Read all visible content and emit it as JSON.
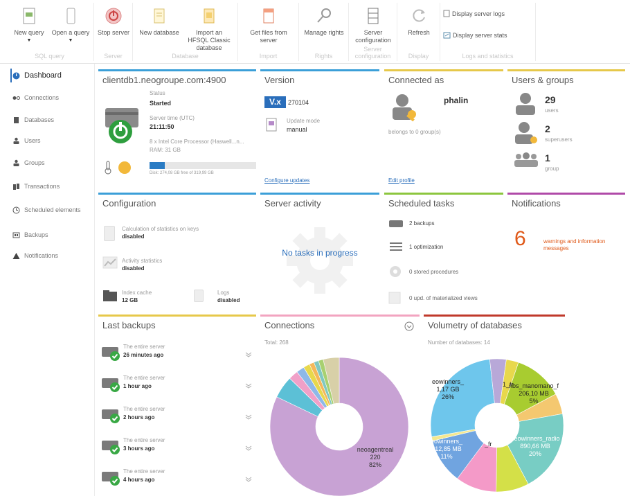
{
  "ribbon": {
    "groups": [
      {
        "title": "SQL query"
      },
      {
        "title": "Server"
      },
      {
        "title": "Database"
      },
      {
        "title": "Import"
      },
      {
        "title": "Rights"
      },
      {
        "title": "Server configuration"
      },
      {
        "title": "Display"
      },
      {
        "title": "Logs and statistics"
      }
    ],
    "buttons": {
      "new_query": "New query",
      "open_query": "Open a query",
      "stop_server": "Stop server",
      "new_database": "New database",
      "import_hfsql": "Import an HFSQL Classic database",
      "get_files": "Get files from server",
      "manage_rights": "Manage rights",
      "server_config": "Server configuration",
      "refresh": "Refresh",
      "display_logs": "Display server logs",
      "display_stats": "Display server stats"
    }
  },
  "sidebar": {
    "items": [
      {
        "label": "Dashboard"
      },
      {
        "label": "Connections"
      },
      {
        "label": "Databases"
      },
      {
        "label": "Users"
      },
      {
        "label": "Groups"
      },
      {
        "label": "Transactions"
      },
      {
        "label": "Scheduled elements"
      },
      {
        "label": "Backups"
      },
      {
        "label": "Notifications"
      }
    ]
  },
  "server": {
    "title": "clientdb1.neogroupe.com:4900",
    "status_label": "Status",
    "status_value": "Started",
    "time_label": "Server time (UTC)",
    "time_value": "21:11:50",
    "cpu": "8 x Intel Core Processor (Haswell...n...",
    "ram": "RAM: 31 GB",
    "disk": "Disk: 274,08 GB free of 319,99 GB",
    "disk_used_fraction": 0.14
  },
  "version": {
    "title": "Version",
    "badge": "V.x",
    "number": "270104",
    "update_label": "Update mode",
    "update_value": "manual",
    "configure_link": "Configure updates"
  },
  "connected": {
    "title": "Connected as",
    "user": "phalin",
    "belongs": "belongs to 0 group(s)",
    "edit_link": "Edit profile"
  },
  "users_groups": {
    "title": "Users & groups",
    "users_count": "29",
    "users_label": "users",
    "super_count": "2",
    "super_label": "superusers",
    "group_count": "1",
    "group_label": "group"
  },
  "configuration": {
    "title": "Configuration",
    "stats_keys_label": "Calculation of statistics on keys",
    "stats_keys_value": "disabled",
    "activity_label": "Activity statistics",
    "activity_value": "disabled",
    "index_label": "Index cache",
    "index_value": "12 GB",
    "logs_label": "Logs",
    "logs_value": "disabled"
  },
  "activity": {
    "title": "Server activity",
    "message": "No tasks in progress"
  },
  "scheduled": {
    "title": "Scheduled tasks",
    "backups": "2 backups",
    "optimization": "1 optimization",
    "procedures": "0 stored procedures",
    "views": "0 upd. of materialized views"
  },
  "notifications": {
    "title": "Notifications",
    "count": "6",
    "text": "warnings and information messages"
  },
  "backups": {
    "title": "Last backups",
    "items": [
      {
        "what": "The entire server",
        "when": "26 minutes ago"
      },
      {
        "what": "The entire server",
        "when": "1 hour ago"
      },
      {
        "what": "The entire server",
        "when": "2 hours ago"
      },
      {
        "what": "The entire server",
        "when": "3 hours ago"
      },
      {
        "what": "The entire server",
        "when": "4 hours ago"
      }
    ]
  },
  "connections": {
    "title": "Connections",
    "total": "Total: 268",
    "label_name": "neoagentreal",
    "label_value": "220",
    "label_pct": "82%",
    "slices": [
      {
        "value": 220,
        "color": "#c8a2d4"
      },
      {
        "value": 14,
        "color": "#5cc0d6"
      },
      {
        "value": 6,
        "color": "#f0a0c8"
      },
      {
        "value": 5,
        "color": "#8eb8e8"
      },
      {
        "value": 4,
        "color": "#e8d84c"
      },
      {
        "value": 3,
        "color": "#f4b85a"
      },
      {
        "value": 3,
        "color": "#80c8c0"
      },
      {
        "value": 3,
        "color": "#a8d070"
      },
      {
        "value": 10,
        "color": "#d8d0a8"
      }
    ]
  },
  "volumetry": {
    "title": "Volumetry of databases",
    "count": "Number of databases: 14",
    "labels": [
      {
        "name": "eowinners_",
        "size": "1,17 GB",
        "pct": "26%"
      },
      {
        "name": "nbs_manomano_f",
        "size": "206,10 MB",
        "pct": "5%"
      },
      {
        "name": "neowinners_radio",
        "size": "890,66 MB",
        "pct": "20%"
      },
      {
        "name": "eowinners_",
        "size": "512,85 MB",
        "pct": "11%"
      },
      {
        "name": "_fr",
        "size": "",
        "pct": ""
      },
      {
        "name": "1_fr",
        "size": "",
        "pct": ""
      }
    ],
    "slices": [
      {
        "value": 26,
        "color": "#6ec6ec"
      },
      {
        "value": 4,
        "color": "#b8a8d8"
      },
      {
        "value": 3,
        "color": "#e8d84c"
      },
      {
        "value": 12,
        "color": "#a8cc30"
      },
      {
        "value": 5,
        "color": "#f4c870"
      },
      {
        "value": 20,
        "color": "#78cdc4"
      },
      {
        "value": 8,
        "color": "#d4e048"
      },
      {
        "value": 10,
        "color": "#f49ac8"
      },
      {
        "value": 11,
        "color": "#70a4e0"
      },
      {
        "value": 1,
        "color": "#f4e890"
      }
    ]
  }
}
